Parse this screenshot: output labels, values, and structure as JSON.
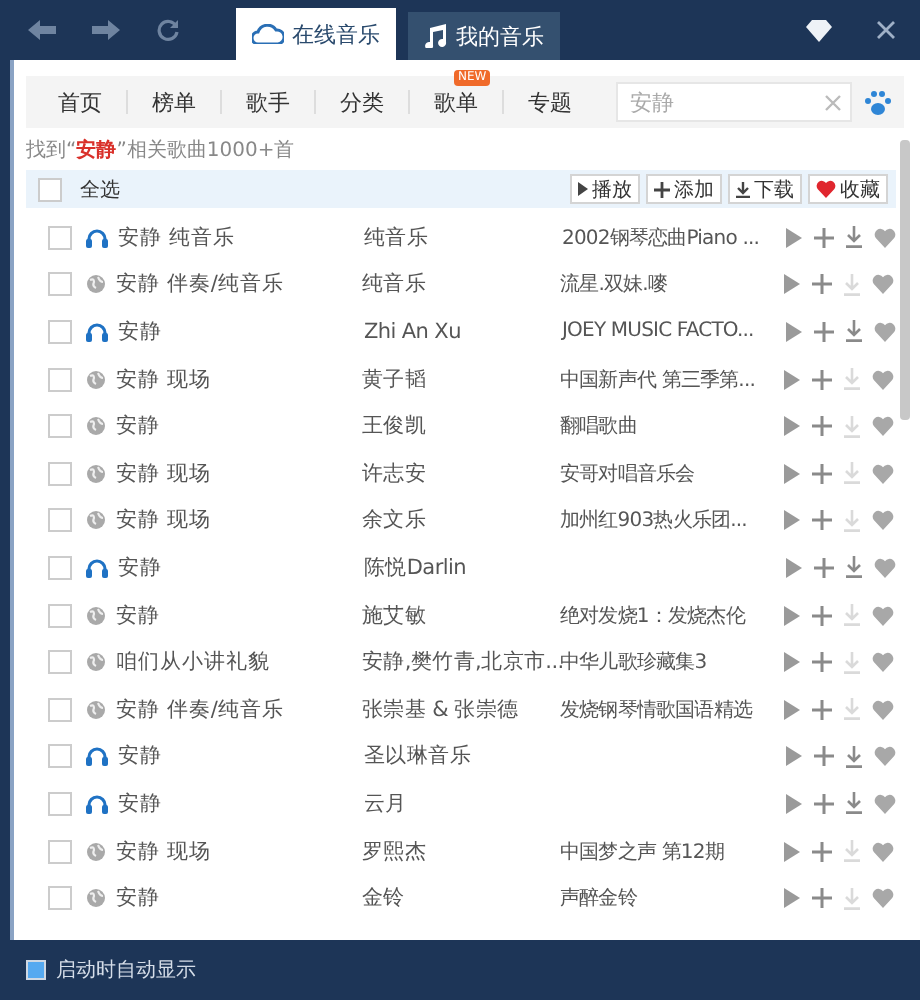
{
  "top_tabs": [
    {
      "label": "在线音乐",
      "selected": true
    },
    {
      "label": "我的音乐",
      "selected": false
    }
  ],
  "nav": [
    {
      "label": "首页"
    },
    {
      "label": "榜单"
    },
    {
      "label": "歌手"
    },
    {
      "label": "分类"
    },
    {
      "label": "歌单",
      "badge": "NEW"
    },
    {
      "label": "专题"
    }
  ],
  "search": {
    "value": "安静"
  },
  "result_text": "找到“**安静**”相关歌曲1000+首",
  "select_all": {
    "label": "全选",
    "checked": false
  },
  "actions": [
    "播放",
    "添加",
    "下载",
    "收藏"
  ],
  "songs": [
    {
      "kind": "headphones",
      "title": "安静 纯音乐",
      "artist": "纯音乐",
      "album": "2002钢琴恋曲Piano ...",
      "downloadable": true,
      "checked": false
    },
    {
      "kind": "globe",
      "title": "安静 伴奏/纯音乐",
      "artist": "纯音乐",
      "album": "流星.双妹.嘜",
      "downloadable": false,
      "checked": false
    },
    {
      "kind": "headphones",
      "title": "安静",
      "artist": "Zhi An Xu",
      "album": "JOEY MUSIC FACTO...",
      "downloadable": true,
      "checked": false
    },
    {
      "kind": "globe",
      "title": "安静 现场",
      "artist": "黄子韬",
      "album": "中国新声代 第三季第...",
      "downloadable": false,
      "checked": false
    },
    {
      "kind": "globe",
      "title": "安静",
      "artist": "王俊凯",
      "album": "翻唱歌曲",
      "downloadable": false,
      "checked": false
    },
    {
      "kind": "globe",
      "title": "安静 现场",
      "artist": "许志安",
      "album": "安哥对唱音乐会",
      "downloadable": false,
      "checked": false
    },
    {
      "kind": "globe",
      "title": "安静 现场",
      "artist": "余文乐",
      "album": "加州红903热火乐团...",
      "downloadable": false,
      "checked": false
    },
    {
      "kind": "headphones",
      "title": "安静",
      "artist": "陈悦Darlin",
      "downloadable": true,
      "checked": false
    },
    {
      "kind": "globe",
      "title": "安静",
      "artist": "施艾敏",
      "album": "绝对发烧1：发烧杰伦",
      "downloadable": false,
      "checked": false
    },
    {
      "kind": "globe",
      "title": "咱们从小讲礼貌",
      "artist": "安静,樊竹青,北京市...",
      "album": "中华儿歌珍藏集3",
      "downloadable": false,
      "checked": false
    },
    {
      "kind": "globe",
      "title": "安静 伴奏/纯音乐",
      "artist": "张崇基 & 张崇德",
      "album": "发烧钢琴情歌国语精选",
      "downloadable": false,
      "checked": false
    },
    {
      "kind": "headphones",
      "title": "安静",
      "artist": "圣以琳音乐",
      "downloadable": true,
      "checked": false
    },
    {
      "kind": "headphones",
      "title": "安静",
      "artist": "云月",
      "downloadable": true,
      "checked": false
    },
    {
      "kind": "globe",
      "title": "安静 现场",
      "artist": "罗熙杰",
      "album": "中国梦之声 第12期",
      "downloadable": false,
      "checked": false
    },
    {
      "kind": "globe",
      "title": "安静",
      "artist": "金铃",
      "album": "声醉金铃",
      "downloadable": false,
      "checked": false
    }
  ],
  "footer": {
    "label": "启动时自动显示",
    "checked": true
  }
}
